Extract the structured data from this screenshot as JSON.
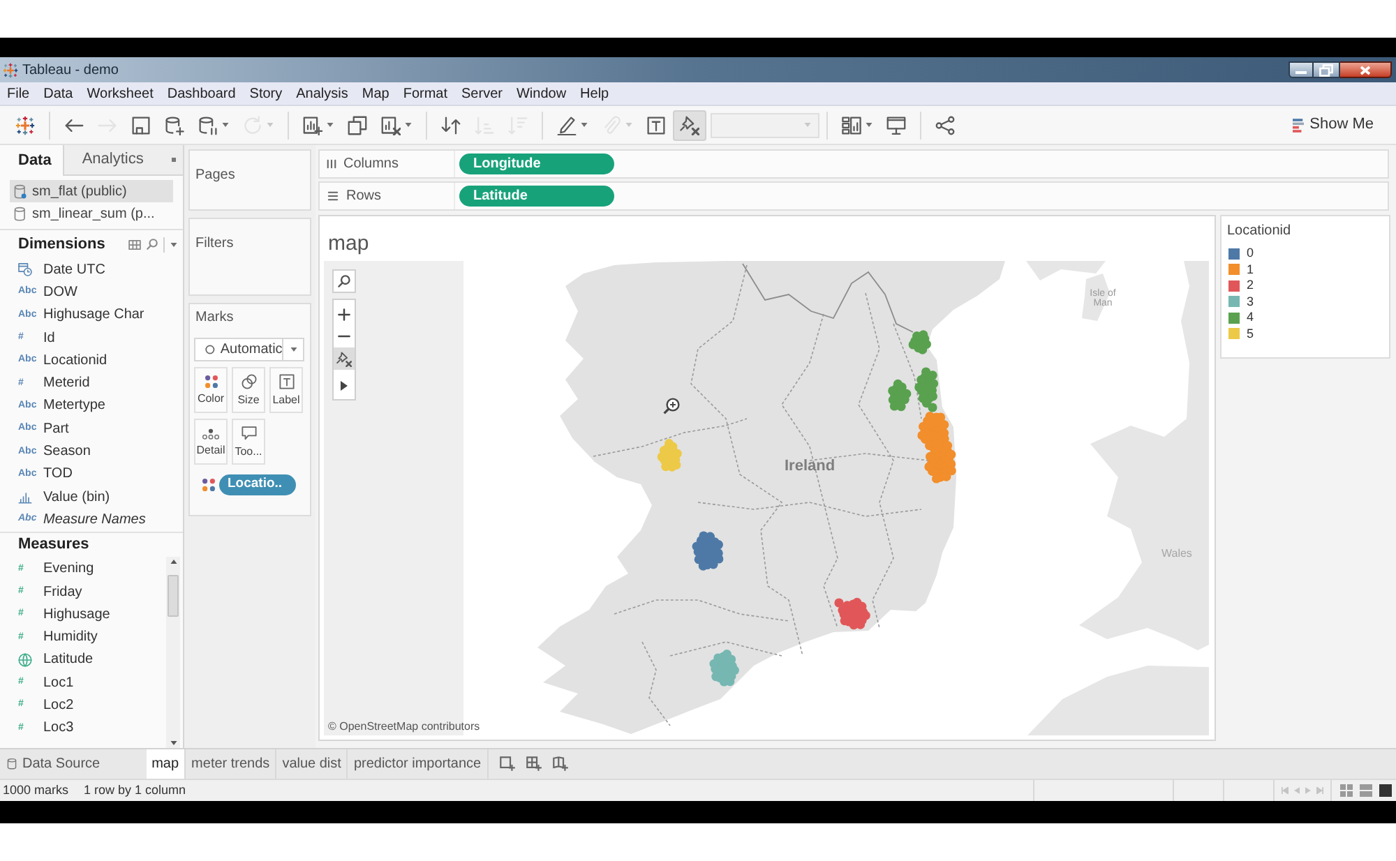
{
  "window": {
    "title": "Tableau - demo"
  },
  "menu": [
    "File",
    "Data",
    "Worksheet",
    "Dashboard",
    "Story",
    "Analysis",
    "Map",
    "Format",
    "Server",
    "Window",
    "Help"
  ],
  "toolbar": {
    "groups": [
      [
        {
          "kind": "button",
          "disabled": false,
          "dropdown": false,
          "pressed": false
        }
      ],
      [
        {
          "kind": "button",
          "disabled": false,
          "dropdown": false,
          "pressed": false
        },
        {
          "kind": "button",
          "disabled": true,
          "dropdown": false,
          "pressed": false
        },
        {
          "kind": "button",
          "disabled": false,
          "dropdown": false,
          "pressed": false
        },
        {
          "kind": "button",
          "disabled": false,
          "dropdown": false,
          "pressed": false
        },
        {
          "kind": "button",
          "disabled": false,
          "dropdown": true,
          "pressed": false
        },
        {
          "kind": "button",
          "disabled": true,
          "dropdown": true,
          "pressed": false
        }
      ],
      [
        {
          "kind": "button",
          "disabled": false,
          "dropdown": true,
          "pressed": false
        },
        {
          "kind": "button",
          "disabled": false,
          "dropdown": false,
          "pressed": false
        },
        {
          "kind": "button",
          "disabled": false,
          "dropdown": true,
          "pressed": false
        }
      ],
      [
        {
          "kind": "button",
          "disabled": false,
          "dropdown": false,
          "pressed": false
        },
        {
          "kind": "button",
          "disabled": true,
          "dropdown": false,
          "pressed": false
        },
        {
          "kind": "button",
          "disabled": true,
          "dropdown": false,
          "pressed": false
        }
      ],
      [
        {
          "kind": "button",
          "disabled": false,
          "dropdown": true,
          "pressed": false
        },
        {
          "kind": "button",
          "disabled": true,
          "dropdown": true,
          "pressed": false
        },
        {
          "kind": "button",
          "disabled": false,
          "dropdown": false,
          "pressed": false
        },
        {
          "kind": "button",
          "disabled": false,
          "dropdown": false,
          "pressed": true
        },
        {
          "kind": "combo",
          "disabled": true
        }
      ],
      [
        {
          "kind": "button",
          "disabled": false,
          "dropdown": true,
          "pressed": false
        },
        {
          "kind": "button",
          "disabled": false,
          "dropdown": false,
          "pressed": false
        }
      ],
      [
        {
          "kind": "button",
          "disabled": false,
          "dropdown": false,
          "pressed": false
        }
      ]
    ],
    "show_me": "Show Me"
  },
  "data_pane": {
    "tabs": [
      {
        "label": "Data",
        "selected": true
      },
      {
        "label": "Analytics",
        "selected": false
      }
    ],
    "sources": [
      {
        "name": "sm_flat (public)",
        "selected": true,
        "primary": true
      },
      {
        "name": "sm_linear_sum (p...",
        "selected": false,
        "primary": false
      }
    ],
    "dimensions": {
      "title": "Dimensions",
      "fields": [
        {
          "name": "Date UTC",
          "kind": "date",
          "italic": false
        },
        {
          "name": "DOW",
          "kind": "glyph",
          "glyph": "Abc",
          "italic": false
        },
        {
          "name": "Highusage Char",
          "kind": "glyph",
          "glyph": "Abc",
          "italic": false
        },
        {
          "name": "Id",
          "kind": "glyph",
          "glyph": "#",
          "italic": false
        },
        {
          "name": "Locationid",
          "kind": "glyph",
          "glyph": "Abc",
          "italic": false
        },
        {
          "name": "Meterid",
          "kind": "glyph",
          "glyph": "#",
          "italic": false
        },
        {
          "name": "Metertype",
          "kind": "glyph",
          "glyph": "Abc",
          "italic": false
        },
        {
          "name": "Part",
          "kind": "glyph",
          "glyph": "Abc",
          "italic": false
        },
        {
          "name": "Season",
          "kind": "glyph",
          "glyph": "Abc",
          "italic": false
        },
        {
          "name": "TOD",
          "kind": "glyph",
          "glyph": "Abc",
          "italic": false
        },
        {
          "name": "Value (bin)",
          "kind": "bin",
          "italic": false
        },
        {
          "name": "Measure Names",
          "kind": "glyph",
          "glyph": "Abc",
          "italic": true
        }
      ]
    },
    "measures": {
      "title": "Measures",
      "fields": [
        {
          "name": "Evening",
          "kind": "glyph",
          "glyph": "#"
        },
        {
          "name": "Friday",
          "kind": "glyph",
          "glyph": "#"
        },
        {
          "name": "Highusage",
          "kind": "glyph",
          "glyph": "#"
        },
        {
          "name": "Humidity",
          "kind": "glyph",
          "glyph": "#"
        },
        {
          "name": "Latitude",
          "kind": "geo"
        },
        {
          "name": "Loc1",
          "kind": "glyph",
          "glyph": "#"
        },
        {
          "name": "Loc2",
          "kind": "glyph",
          "glyph": "#"
        },
        {
          "name": "Loc3",
          "kind": "glyph",
          "glyph": "#"
        }
      ]
    }
  },
  "cards": {
    "pages": {
      "title": "Pages"
    },
    "filters": {
      "title": "Filters"
    },
    "marks": {
      "title": "Marks",
      "mark_type": "Automatic",
      "buttons": [
        {
          "label": "Color",
          "kind": "color"
        },
        {
          "label": "Size",
          "kind": "size"
        },
        {
          "label": "Label",
          "kind": "label"
        },
        {
          "label": "Detail",
          "kind": "detail"
        },
        {
          "label": "Too...",
          "kind": "tooltip"
        }
      ],
      "pills": [
        {
          "label": "Locatio..",
          "kind": "color"
        }
      ]
    }
  },
  "shelves": [
    {
      "label": "Columns",
      "kind": "columns",
      "pills": [
        "Longitude"
      ]
    },
    {
      "label": "Rows",
      "kind": "rows",
      "pills": [
        "Latitude"
      ]
    }
  ],
  "view": {
    "title": "map",
    "map_tools": [
      {
        "pressed": false
      },
      {
        "pressed": false
      },
      {
        "pressed": false
      },
      {
        "pressed": true
      },
      {
        "pressed": false
      }
    ],
    "map_labels": [
      {
        "text": "Ireland",
        "kind": "country"
      },
      {
        "text": "Isle of Man",
        "kind": "island"
      },
      {
        "text": "Wales",
        "kind": "region"
      }
    ],
    "attribution": "© OpenStreetMap contributors"
  },
  "legend": {
    "title": "Locationid",
    "items": [
      {
        "label": "0",
        "color": "#4e79a7"
      },
      {
        "label": "1",
        "color": "#f28e2b"
      },
      {
        "label": "2",
        "color": "#e15759"
      },
      {
        "label": "3",
        "color": "#76b7b2"
      },
      {
        "label": "4",
        "color": "#59a14f"
      },
      {
        "label": "5",
        "color": "#edc948"
      }
    ]
  },
  "sheet_tabs": {
    "data_source": "Data Source",
    "sheets": [
      {
        "label": "map",
        "selected": true
      },
      {
        "label": "meter trends",
        "selected": false
      },
      {
        "label": "value dist",
        "selected": false
      },
      {
        "label": "predictor importance",
        "selected": false
      }
    ]
  },
  "status_bar": {
    "marks": "1000 marks",
    "layout": "1 row by 1 column"
  }
}
